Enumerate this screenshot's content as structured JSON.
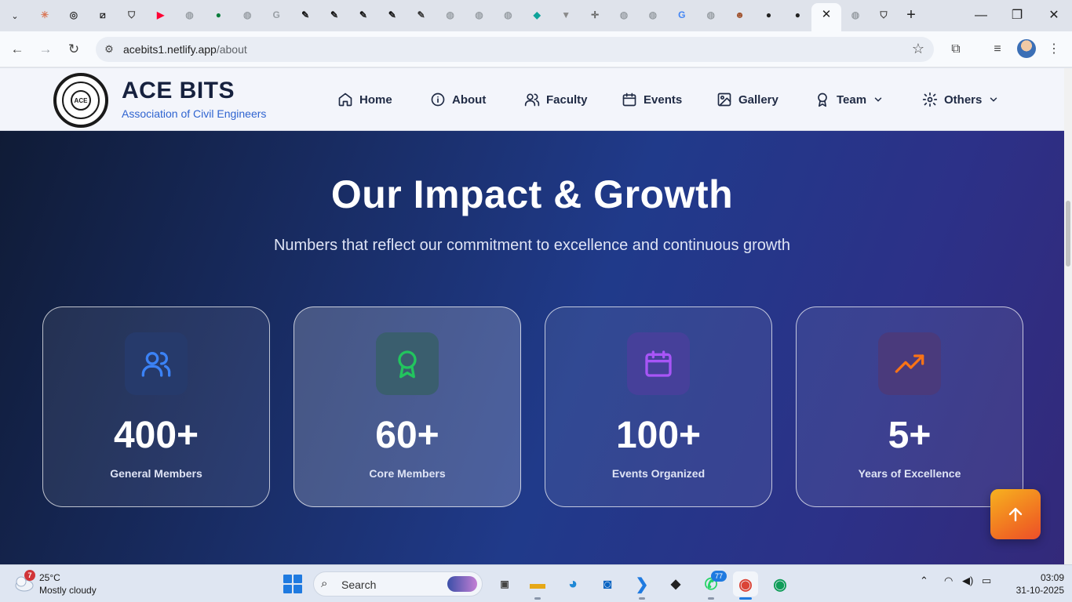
{
  "browser": {
    "favicons": [
      {
        "name": "claude-icon",
        "glyph": "✳",
        "color": "#d97757"
      },
      {
        "name": "chatgpt-icon",
        "glyph": "◎",
        "color": "#333333"
      },
      {
        "name": "perplexity-icon",
        "glyph": "⧄",
        "color": "#222222"
      },
      {
        "name": "chrome-shield-icon",
        "glyph": "⛉",
        "color": "#444444"
      },
      {
        "name": "youtube-icon",
        "glyph": "▶",
        "color": "#ff0033"
      },
      {
        "name": "globe-icon",
        "glyph": "◍",
        "color": "#9aa0a6"
      },
      {
        "name": "leaf-icon",
        "glyph": "●",
        "color": "#0a7d3b"
      },
      {
        "name": "globe-icon",
        "glyph": "◍",
        "color": "#9aa0a6"
      },
      {
        "name": "google-icon",
        "glyph": "G",
        "color": "#9aa0a6"
      },
      {
        "name": "pen-icon",
        "glyph": "✎",
        "color": "#111111"
      },
      {
        "name": "pen-icon",
        "glyph": "✎",
        "color": "#111111"
      },
      {
        "name": "pen-icon",
        "glyph": "✎",
        "color": "#111111"
      },
      {
        "name": "pen-icon",
        "glyph": "✎",
        "color": "#111111"
      },
      {
        "name": "pen-icon",
        "glyph": "✎",
        "color": "#333333"
      },
      {
        "name": "globe-icon",
        "glyph": "◍",
        "color": "#9aa0a6"
      },
      {
        "name": "globe-icon",
        "glyph": "◍",
        "color": "#9aa0a6"
      },
      {
        "name": "globe-icon",
        "glyph": "◍",
        "color": "#9aa0a6"
      },
      {
        "name": "diamond-icon",
        "glyph": "◆",
        "color": "#0fa39a"
      },
      {
        "name": "funnel-icon",
        "glyph": "▼",
        "color": "#8a8a8a"
      },
      {
        "name": "crosshair-icon",
        "glyph": "✛",
        "color": "#666666"
      },
      {
        "name": "globe-icon",
        "glyph": "◍",
        "color": "#9aa0a6"
      },
      {
        "name": "globe-icon",
        "glyph": "◍",
        "color": "#9aa0a6"
      },
      {
        "name": "google-icon",
        "glyph": "G",
        "color": "#4285f4"
      },
      {
        "name": "globe-icon",
        "glyph": "◍",
        "color": "#9aa0a6"
      },
      {
        "name": "person-icon",
        "glyph": "☻",
        "color": "#a0522d"
      },
      {
        "name": "github-icon",
        "glyph": "●",
        "color": "#222222"
      },
      {
        "name": "github-icon",
        "glyph": "●",
        "color": "#222222"
      }
    ],
    "after_tabs": [
      {
        "name": "globe-icon",
        "glyph": "◍",
        "color": "#9aa0a6"
      },
      {
        "name": "chrome-shield-icon",
        "glyph": "⛉",
        "color": "#444444"
      }
    ],
    "close_glyph": "✕",
    "new_tab_glyph": "+",
    "url_host": "acebits1.netlify.app",
    "url_path": "/about"
  },
  "site": {
    "brand_name": "ACE BITS",
    "brand_sub": "Association of Civil Engineers",
    "logo_text": "ACE",
    "nav": [
      {
        "label": "Home",
        "icon": "home-icon",
        "dropdown": false
      },
      {
        "label": "About",
        "icon": "info-icon",
        "dropdown": false
      },
      {
        "label": "Faculty",
        "icon": "users-icon",
        "dropdown": false
      },
      {
        "label": "Events",
        "icon": "calendar-icon",
        "dropdown": false
      },
      {
        "label": "Gallery",
        "icon": "image-icon",
        "dropdown": false
      },
      {
        "label": "Team",
        "icon": "award-icon",
        "dropdown": true
      },
      {
        "label": "Others",
        "icon": "gear-icon",
        "dropdown": true
      }
    ]
  },
  "impact": {
    "title": "Our Impact & Growth",
    "subtitle": "Numbers that reflect our commitment to excellence and continuous growth",
    "stats": [
      {
        "value": "400+",
        "label": "General Members",
        "icon": "users-icon",
        "color": "#3b82f6",
        "box": "#263a6b"
      },
      {
        "value": "60+",
        "label": "Core Members",
        "icon": "award-icon",
        "color": "#22c55e",
        "box": "#3a5e6e"
      },
      {
        "value": "100+",
        "label": "Events Organized",
        "icon": "calendar-icon",
        "color": "#a855f7",
        "box": "#46409a"
      },
      {
        "value": "5+",
        "label": "Years of Excellence",
        "icon": "trending-up-icon",
        "color": "#f97316",
        "box": "#4a3a7c"
      }
    ]
  },
  "taskbar": {
    "weather_badge": "7",
    "temperature": "25°C",
    "conditions": "Mostly cloudy",
    "search_label": "Search",
    "whatsapp_badge": "77",
    "time": "03:09",
    "date": "31-10-2025"
  }
}
